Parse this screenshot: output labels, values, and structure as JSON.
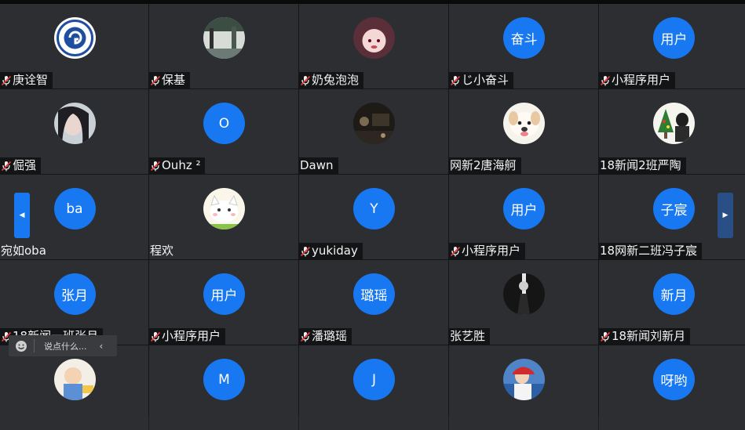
{
  "participants": [
    {
      "name": "庚诠智",
      "muted": true,
      "avatar": {
        "kind": "image",
        "icon": "university-seal-icon"
      }
    },
    {
      "name": "保基",
      "muted": true,
      "avatar": {
        "kind": "image",
        "icon": "street-photo-icon"
      }
    },
    {
      "name": "奶兔泡泡",
      "muted": true,
      "avatar": {
        "kind": "image",
        "icon": "anime-girl-icon"
      }
    },
    {
      "name": "じ小奋斗",
      "muted": true,
      "avatar": {
        "kind": "text",
        "text": "奋斗"
      }
    },
    {
      "name": "小程序用户",
      "muted": true,
      "avatar": {
        "kind": "text",
        "text": "用户"
      }
    },
    {
      "name": "倔强",
      "muted": true,
      "avatar": {
        "kind": "image",
        "icon": "portrait-photo-icon"
      }
    },
    {
      "name": "Ouhz ²",
      "muted": true,
      "avatar": {
        "kind": "text",
        "text": "O"
      }
    },
    {
      "name": "Dawn",
      "muted": false,
      "avatar": {
        "kind": "image",
        "icon": "dark-scene-icon"
      }
    },
    {
      "name": "网新2唐海舸",
      "muted": false,
      "avatar": {
        "kind": "image",
        "icon": "puppy-photo-icon"
      }
    },
    {
      "name": "18新闻2班严陶",
      "muted": false,
      "avatar": {
        "kind": "image",
        "icon": "christmas-tree-icon"
      }
    },
    {
      "name": "宛如oba",
      "muted": false,
      "avatar": {
        "kind": "text",
        "text": "ba"
      }
    },
    {
      "name": "程欢",
      "muted": false,
      "avatar": {
        "kind": "image",
        "icon": "cartoon-cat-icon"
      }
    },
    {
      "name": "yukiday",
      "muted": true,
      "avatar": {
        "kind": "text",
        "text": "Y"
      }
    },
    {
      "name": "小程序用户",
      "muted": true,
      "avatar": {
        "kind": "text",
        "text": "用户"
      }
    },
    {
      "name": "18网新二班冯子宸",
      "muted": false,
      "avatar": {
        "kind": "text",
        "text": "子宸"
      }
    },
    {
      "name": "18新闻一班张月",
      "muted": true,
      "avatar": {
        "kind": "text",
        "text": "张月"
      }
    },
    {
      "name": "小程序用户",
      "muted": true,
      "avatar": {
        "kind": "text",
        "text": "用户"
      }
    },
    {
      "name": "潘璐瑶",
      "muted": true,
      "avatar": {
        "kind": "text",
        "text": "璐瑶"
      }
    },
    {
      "name": "张艺胜",
      "muted": false,
      "avatar": {
        "kind": "image",
        "icon": "silhouette-photo-icon"
      }
    },
    {
      "name": "18新闻刘新月",
      "muted": true,
      "avatar": {
        "kind": "text",
        "text": "新月"
      }
    },
    {
      "name": "",
      "muted": false,
      "avatar": {
        "kind": "image",
        "icon": "baby-photo-icon"
      }
    },
    {
      "name": "",
      "muted": false,
      "avatar": {
        "kind": "text",
        "text": "M"
      }
    },
    {
      "name": "",
      "muted": false,
      "avatar": {
        "kind": "text",
        "text": "J"
      }
    },
    {
      "name": "",
      "muted": false,
      "avatar": {
        "kind": "image",
        "icon": "red-hat-photo-icon"
      }
    },
    {
      "name": "",
      "muted": false,
      "avatar": {
        "kind": "text",
        "text": "呀哟"
      }
    }
  ],
  "navigation": {
    "prev_icon": "chevron-left-icon",
    "next_icon": "chevron-right-icon"
  },
  "chat": {
    "placeholder": "说点什么...",
    "emoji_icon": "smile-icon",
    "collapse_icon": "chevron-left-icon"
  },
  "colors": {
    "accent": "#1778f2",
    "tile": "#2c2e32",
    "label_bg": "#131416",
    "mic_red": "#e23b3b"
  }
}
